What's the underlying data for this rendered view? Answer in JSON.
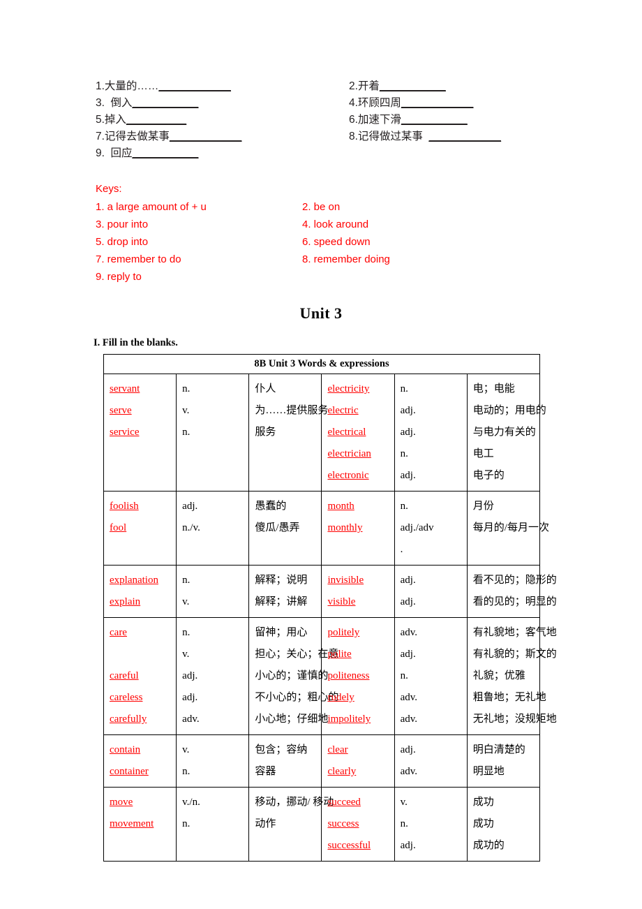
{
  "exercise": {
    "rows": [
      {
        "left": "1.大量的……",
        "left_blank": "____________",
        "right": "2.开着",
        "right_blank": "___________"
      },
      {
        "left": "3.  倒入",
        "left_blank": "___________",
        "right": "4.环顾四周",
        "right_blank": "____________"
      },
      {
        "left": "5.掉入",
        "left_blank": "__________",
        "right": "6.加速下滑",
        "right_blank": "___________"
      },
      {
        "left": "7.记得去做某事",
        "left_blank": "____________",
        "right": "8.记得做过某事  ",
        "right_blank": "____________"
      },
      {
        "left": "9.  回应",
        "left_blank": "___________",
        "right": "",
        "right_blank": ""
      }
    ]
  },
  "keys": {
    "title": "Keys:",
    "rows": [
      {
        "left": "1. a large amount of + u",
        "right": "2. be on"
      },
      {
        "left": "3. pour into",
        "right": "4. look around"
      },
      {
        "left": "5. drop into",
        "right": "6. speed down"
      },
      {
        "left": "7. remember to do",
        "right": "8. remember doing"
      },
      {
        "left": "9. reply to",
        "right": ""
      }
    ],
    "color": "#ff0000"
  },
  "unit": {
    "title": "Unit 3",
    "section": "I. Fill in the blanks."
  },
  "vocab_table": {
    "caption": "8B Unit 3 Words & expressions",
    "word_color": "#ff0000",
    "rows": [
      {
        "left_words": [
          "servant",
          "serve",
          "service"
        ],
        "left_pos": [
          "n.",
          "v.",
          "n."
        ],
        "left_mean": [
          "仆人",
          "为……提供服务",
          "服务"
        ],
        "right_words": [
          "electricity",
          "electric",
          "electrical",
          "electrician",
          "electronic"
        ],
        "right_pos": [
          "n.",
          "adj.",
          "adj.",
          "n.",
          "adj."
        ],
        "right_mean": [
          "电；电能",
          "电动的；用电的",
          "与电力有关的",
          "电工",
          "电子的"
        ]
      },
      {
        "left_words": [
          "foolish",
          "fool"
        ],
        "left_pos": [
          "adj.",
          "n./v."
        ],
        "left_mean": [
          "愚蠢的",
          "傻瓜/愚弄"
        ],
        "right_words": [
          "month",
          "monthly"
        ],
        "right_pos": [
          "n.",
          "adj./adv",
          "."
        ],
        "right_mean": [
          "月份",
          "每月的/每月一次"
        ]
      },
      {
        "left_words": [
          "explanation",
          "explain"
        ],
        "left_pos": [
          "n.",
          "v."
        ],
        "left_mean": [
          "解释；说明",
          "解释；讲解"
        ],
        "right_words": [
          "invisible",
          "visible"
        ],
        "right_pos": [
          "adj.",
          "adj."
        ],
        "right_mean": [
          "看不见的；隐形的",
          "看的见的；明显的"
        ]
      },
      {
        "left_words": [
          "care",
          "",
          "careful",
          "careless",
          "carefully"
        ],
        "left_pos": [
          "n.",
          "v.",
          "adj.",
          "adj.",
          "adv."
        ],
        "left_mean": [
          "留神；用心",
          "担心；关心；在意",
          "小心的；谨慎的",
          "不小心的；粗心的",
          "小心地；仔细地"
        ],
        "right_words": [
          "politely",
          "polite",
          "politeness",
          "rudely",
          "impolitely"
        ],
        "right_pos": [
          "adv.",
          "adj.",
          "n.",
          "adv.",
          "adv."
        ],
        "right_mean": [
          "有礼貌地；客气地",
          "有礼貌的；斯文的",
          "礼貌；优雅",
          "粗鲁地；无礼地",
          "无礼地；没规矩地"
        ]
      },
      {
        "left_words": [
          "contain",
          "container"
        ],
        "left_pos": [
          "v.",
          "n."
        ],
        "left_mean": [
          "包含；容纳",
          "容器"
        ],
        "right_words": [
          "clear",
          "clearly"
        ],
        "right_pos": [
          "adj.",
          "adv."
        ],
        "right_mean": [
          "明白清楚的",
          "明显地"
        ]
      },
      {
        "left_words": [
          "move",
          "movement"
        ],
        "left_pos": [
          "v./n.",
          "n."
        ],
        "left_mean": [
          "移动，挪动/ 移动",
          "动作"
        ],
        "right_words": [
          "succeed",
          "success",
          "successful"
        ],
        "right_pos": [
          "v.",
          "n.",
          "adj."
        ],
        "right_mean": [
          "成功",
          "成功",
          "成功的"
        ]
      }
    ]
  }
}
